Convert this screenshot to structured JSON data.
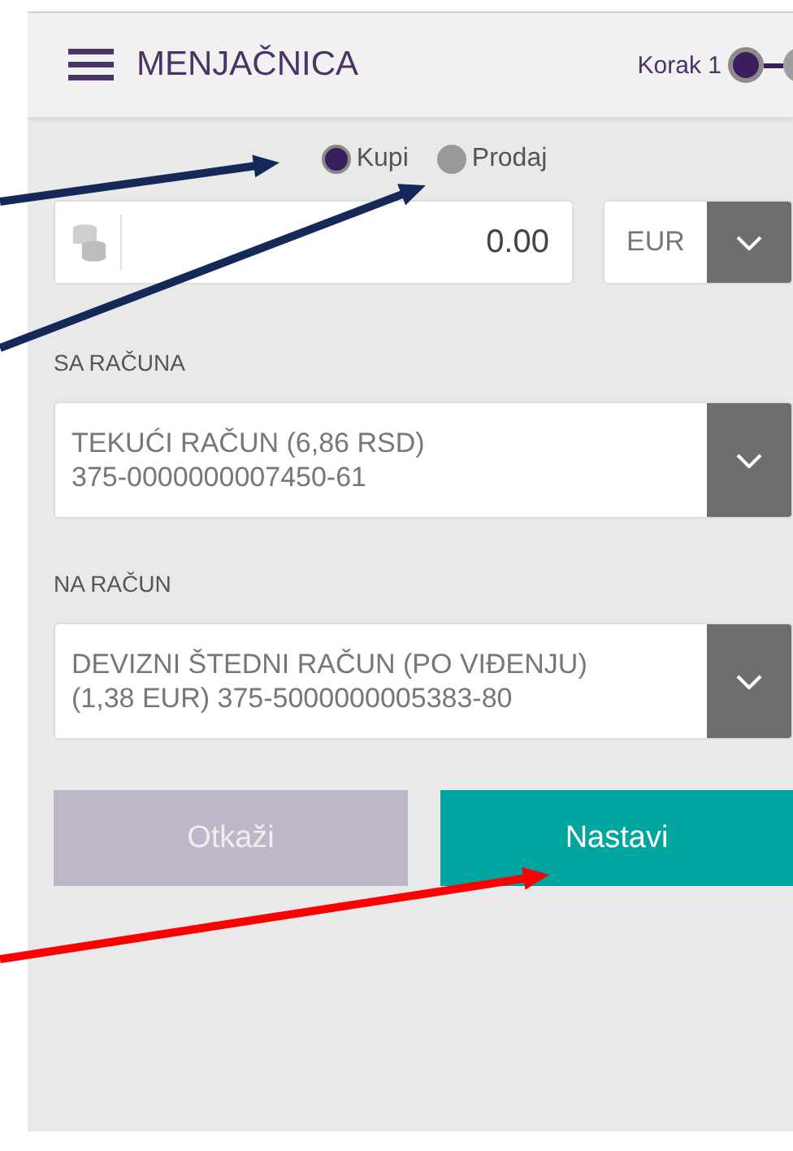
{
  "header": {
    "title": "MENJAČNICA",
    "step_label": "Korak 1",
    "steps": [
      {
        "selected": true
      },
      {
        "selected": false
      }
    ]
  },
  "operation": [
    {
      "label": "Kupi",
      "selected": true
    },
    {
      "label": "Prodaj",
      "selected": false
    }
  ],
  "amount": {
    "value": "0.00",
    "currency": "EUR"
  },
  "from_account": {
    "label": "SA RAČUNA",
    "line_1": "TEKUĆI RAČUN (6,86 RSD)",
    "line_2": "375-0000000007450-61"
  },
  "to_account": {
    "label": "NA RAČUN",
    "line_1": "DEVIZNI ŠTEDNI RAČUN (PO VIĐENJU)",
    "line_2": "(1,38 EUR) 375-5000000005383-80"
  },
  "buttons": [
    {
      "label": "Otkaži",
      "kind": "cancel"
    },
    {
      "label": "Nastavi",
      "kind": "primary"
    }
  ],
  "annotation_arrows": [
    {
      "color": "#14285a"
    },
    {
      "color": "#14285a"
    },
    {
      "color": "#ff0000"
    }
  ]
}
